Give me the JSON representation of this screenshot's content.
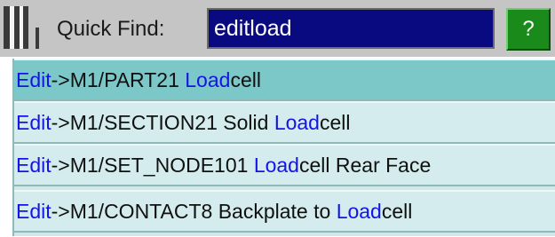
{
  "toolbar": {
    "quick_find_label": "Quick Find:",
    "search_value": "editload",
    "help_label": "?"
  },
  "results": [
    {
      "prefix": "Edit",
      "before": "->M1/PART21 ",
      "match": "Load",
      "after": "cell",
      "selected": true
    },
    {
      "prefix": "Edit",
      "before": "->M1/SECTION21 Solid ",
      "match": "Load",
      "after": "cell",
      "selected": false
    },
    {
      "prefix": "Edit",
      "before": "->M1/SET_NODE101 ",
      "match": "Load",
      "after": "cell Rear Face",
      "selected": false
    },
    {
      "prefix": "Edit",
      "before": "->M1/CONTACT8 Backplate to ",
      "match": "Load",
      "after": "cell",
      "selected": false
    }
  ],
  "colors": {
    "toolbar_bg": "#c5c5c5",
    "input_bg": "#0a0a80",
    "help_button_bg": "#1a8a1a",
    "row_selected_bg": "#7cc8c8",
    "row_bg": "#d4eced",
    "highlight_text": "#1414e6"
  },
  "icons": {
    "grip": "toolbar-grip-icon"
  }
}
